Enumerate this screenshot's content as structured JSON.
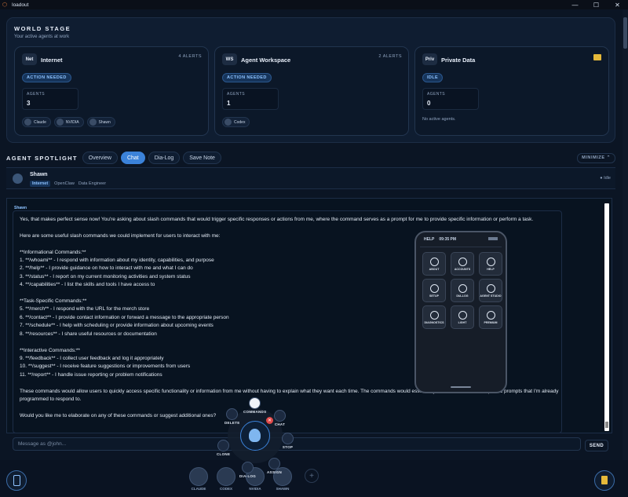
{
  "app": {
    "title": "loadout",
    "window_controls": [
      "—",
      "☐",
      "✕"
    ]
  },
  "world_stage": {
    "title": "WORLD STAGE",
    "subtitle": "Your active agents at work",
    "cards": [
      {
        "tag": "Net",
        "name": "Internet",
        "alerts": "4 ALERTS",
        "badge": "ACTION NEEDED",
        "agents_label": "AGENTS",
        "agents_count": "3",
        "chips": [
          "Claude",
          "NVIDIA",
          "Shawn"
        ]
      },
      {
        "tag": "WS",
        "name": "Agent Workspace",
        "alerts": "2 ALERTS",
        "badge": "ACTION NEEDED",
        "agents_label": "AGENTS",
        "agents_count": "1",
        "chips": [
          "Codex"
        ]
      },
      {
        "tag": "Priv",
        "name": "Private Data",
        "alerts": "",
        "badge": "IDLE",
        "agents_label": "AGENTS",
        "agents_count": "0",
        "no_active": "No active agents."
      }
    ]
  },
  "spotlight": {
    "title": "AGENT SPOTLIGHT",
    "tabs": [
      "Overview",
      "Chat",
      "Dia-Log",
      "Save Note"
    ],
    "active_tab": "Chat",
    "minimize": "MINIMIZE",
    "agent": {
      "name": "Shawn",
      "zone": "Internet",
      "platform": "OpenClaw",
      "role": "Data Engineer",
      "status": "Idle"
    }
  },
  "chat": {
    "sender": "Shawn",
    "message": "Yes, that makes perfect sense now! You're asking about slash commands that would trigger specific responses or actions from me, where the command serves as a prompt for me to provide specific information or perform a task.\n\nHere are some useful slash commands we could implement for users to interact with me:\n\n**Informational Commands:**\n1. **/whoami** - I respond with information about my identity, capabilities, and purpose\n2. **/help** - I provide guidance on how to interact with me and what I can do\n3. **/status** - I report on my current monitoring activities and system status\n4. **/capabilities** - I list the skills and tools I have access to\n\n**Task-Specific Commands:**\n5. **/merch** - I respond with the URL for the merch store\n6. **/contact** - I provide contact information or forward a message to the appropriate person\n7. **/schedule** - I help with scheduling or provide information about upcoming events\n8. **/resources** - I share useful resources or documentation\n\n**Interactive Commands:**\n9. **/feedback** - I collect user feedback and log it appropriately\n10. **/suggest** - I receive feature suggestions or improvements from users\n11. **/report** - I handle issue reporting or problem notifications\n\nThese commands would allow users to quickly access specific functionality or information from me without having to explain what they want each time. The commands would essentially serve as shortcuts to specific prompts that I'm already programmed to respond to.\n\nWould you like me to elaborate on any of these commands or suggest additional ones?",
    "input_placeholder": "Message as @john...",
    "send_label": "SEND"
  },
  "phone": {
    "help_label": "HELP",
    "time": "09:35 PM",
    "tiles": [
      "ABOUT",
      "ACCOUNTS",
      "HELP",
      "SETUP",
      "DIA-LOG",
      "AGENT STUDIO",
      "DIAGNOSTICS",
      "LIGHT",
      "PREMIUM"
    ]
  },
  "radial_menu": {
    "items": [
      "COMMANDS",
      "CHAT",
      "STOP",
      "ASSIGN",
      "DIA-LOG",
      "CLONE",
      "DELETE"
    ],
    "close": "✕"
  },
  "dock": {
    "agents": [
      "CLAUDE",
      "CODEX",
      "NVIDIA",
      "SHAWN"
    ],
    "add": "+"
  }
}
